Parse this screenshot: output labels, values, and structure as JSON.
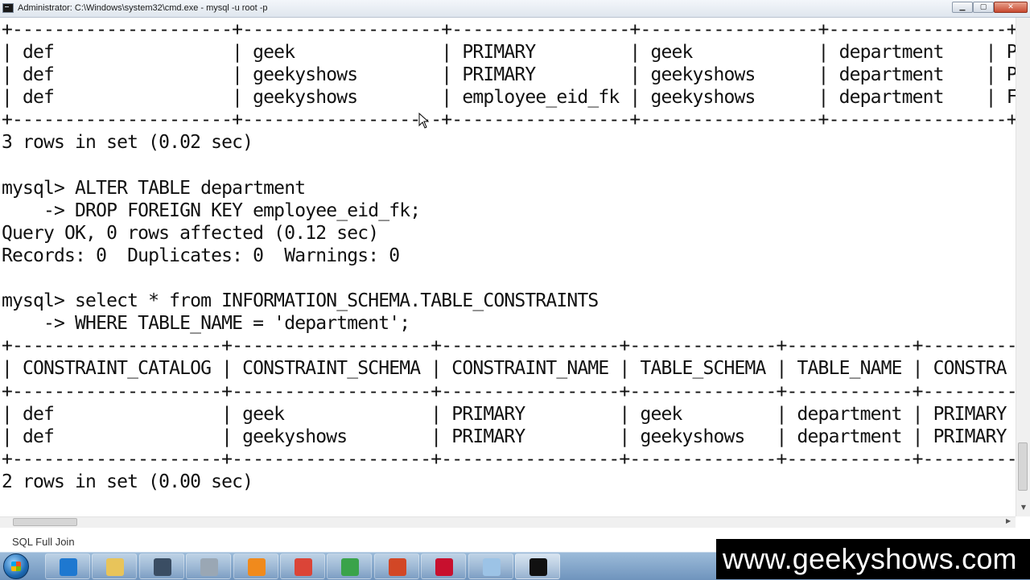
{
  "window": {
    "title": "Administrator: C:\\Windows\\system32\\cmd.exe - mysql  -u root -p",
    "minimize_glyph": "▁",
    "maximize_glyph": "▢",
    "close_glyph": "✕"
  },
  "console": {
    "lines": [
      "+---------------------+-------------------+-----------------+-----------------+-----------------+---------------",
      "| def                 | geek              | PRIMARY         | geek            | department    | PRIMARY",
      "| def                 | geekyshows        | PRIMARY         | geekyshows      | department    | PRIMARY",
      "| def                 | geekyshows        | employee_eid_fk | geekyshows      | department    | FOREIGN",
      "+---------------------+-------------------+-----------------+-----------------+-----------------+---------------",
      "3 rows in set (0.02 sec)",
      "",
      "mysql> ALTER TABLE department",
      "    -> DROP FOREIGN KEY employee_eid_fk;",
      "Query OK, 0 rows affected (0.12 sec)",
      "Records: 0  Duplicates: 0  Warnings: 0",
      "",
      "mysql> select * from INFORMATION_SCHEMA.TABLE_CONSTRAINTS",
      "    -> WHERE TABLE_NAME = 'department';",
      "+--------------------+-------------------+-----------------+--------------+------------+-----------",
      "| CONSTRAINT_CATALOG | CONSTRAINT_SCHEMA | CONSTRAINT_NAME | TABLE_SCHEMA | TABLE_NAME | CONSTRA",
      "+--------------------+-------------------+-----------------+--------------+------------+-----------",
      "| def                | geek              | PRIMARY         | geek         | department | PRIMARY",
      "| def                | geekyshows        | PRIMARY         | geekyshows   | department | PRIMARY",
      "+--------------------+-------------------+-----------------+--------------+------------+-----------",
      "2 rows in set (0.00 sec)"
    ]
  },
  "scrollbars": {
    "vertical_down_arrow": "▼",
    "horizontal_right_arrow": "▶"
  },
  "caption": "SQL Full Join",
  "taskbar": {
    "items": [
      {
        "icon": "internet-explorer-icon",
        "color": "#1e78d0"
      },
      {
        "icon": "file-explorer-icon",
        "color": "#e8c45a"
      },
      {
        "icon": "reader-app-icon",
        "color": "#3a4d63"
      },
      {
        "icon": "snipping-tool-icon",
        "color": "#9aa7b4"
      },
      {
        "icon": "media-player-icon",
        "color": "#f08a1c"
      },
      {
        "icon": "chrome-icon",
        "color": "#db4437"
      },
      {
        "icon": "green-app-icon",
        "color": "#3aa34a"
      },
      {
        "icon": "powerpoint-icon",
        "color": "#d24726"
      },
      {
        "icon": "acrobat-icon",
        "color": "#c8102e"
      },
      {
        "icon": "notepad-icon",
        "color": "#9cc3e6"
      },
      {
        "icon": "cmd-icon",
        "color": "#111111"
      }
    ]
  },
  "brand": "www.geekyshows.com"
}
